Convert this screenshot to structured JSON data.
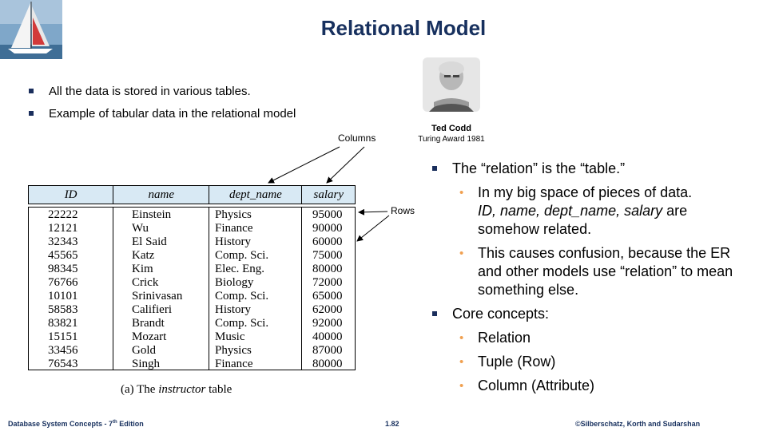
{
  "slide": {
    "title": "Relational Model",
    "top_bullets": [
      "All the data is stored in various tables.",
      "Example  of tabular  data  in  the  relational  model"
    ],
    "portrait": {
      "name": "Ted Codd",
      "award": "Turing Award 1981"
    },
    "annotations": {
      "columns": "Columns",
      "rows": "Rows"
    },
    "table": {
      "headers": [
        "ID",
        "name",
        "dept_name",
        "salary"
      ],
      "rows": [
        [
          "22222",
          "Einstein",
          "Physics",
          "95000"
        ],
        [
          "12121",
          "Wu",
          "Finance",
          "90000"
        ],
        [
          "32343",
          "El Said",
          "History",
          "60000"
        ],
        [
          "45565",
          "Katz",
          "Comp. Sci.",
          "75000"
        ],
        [
          "98345",
          "Kim",
          "Elec. Eng.",
          "80000"
        ],
        [
          "76766",
          "Crick",
          "Biology",
          "72000"
        ],
        [
          "10101",
          "Srinivasan",
          "Comp. Sci.",
          "65000"
        ],
        [
          "58583",
          "Califieri",
          "History",
          "62000"
        ],
        [
          "83821",
          "Brandt",
          "Comp. Sci.",
          "92000"
        ],
        [
          "15151",
          "Mozart",
          "Music",
          "40000"
        ],
        [
          "33456",
          "Gold",
          "Physics",
          "87000"
        ],
        [
          "76543",
          "Singh",
          "Finance",
          "80000"
        ]
      ],
      "caption_prefix": "(a) The ",
      "caption_italic": "instructor",
      "caption_suffix": " table"
    },
    "right_bullets": {
      "b1": "The “relation” is the “table.”",
      "b1_sub1_line1": "In my big space of pieces of data.",
      "b1_sub1_line2_italic": "ID, name, dept_name, salary",
      "b1_sub1_line2_rest": " are",
      "b1_sub1_line3": "somehow related.",
      "b1_sub2": "This causes confusion, because the ER and other models use “relation” to mean something else.",
      "b2": "Core concepts:",
      "b2_subs": [
        "Relation",
        "Tuple (Row)",
        "Column (Attribute)"
      ]
    },
    "footer": {
      "left_prefix": "Database System Concepts - 7",
      "left_sup": "th",
      "left_suffix": " Edition",
      "center": "1.82",
      "right": "©Silberschatz, Korth and Sudarshan"
    },
    "colors": {
      "title": "#17305e",
      "sub_bullet": "#f0a050",
      "table_header": "#d8e9f4"
    }
  }
}
